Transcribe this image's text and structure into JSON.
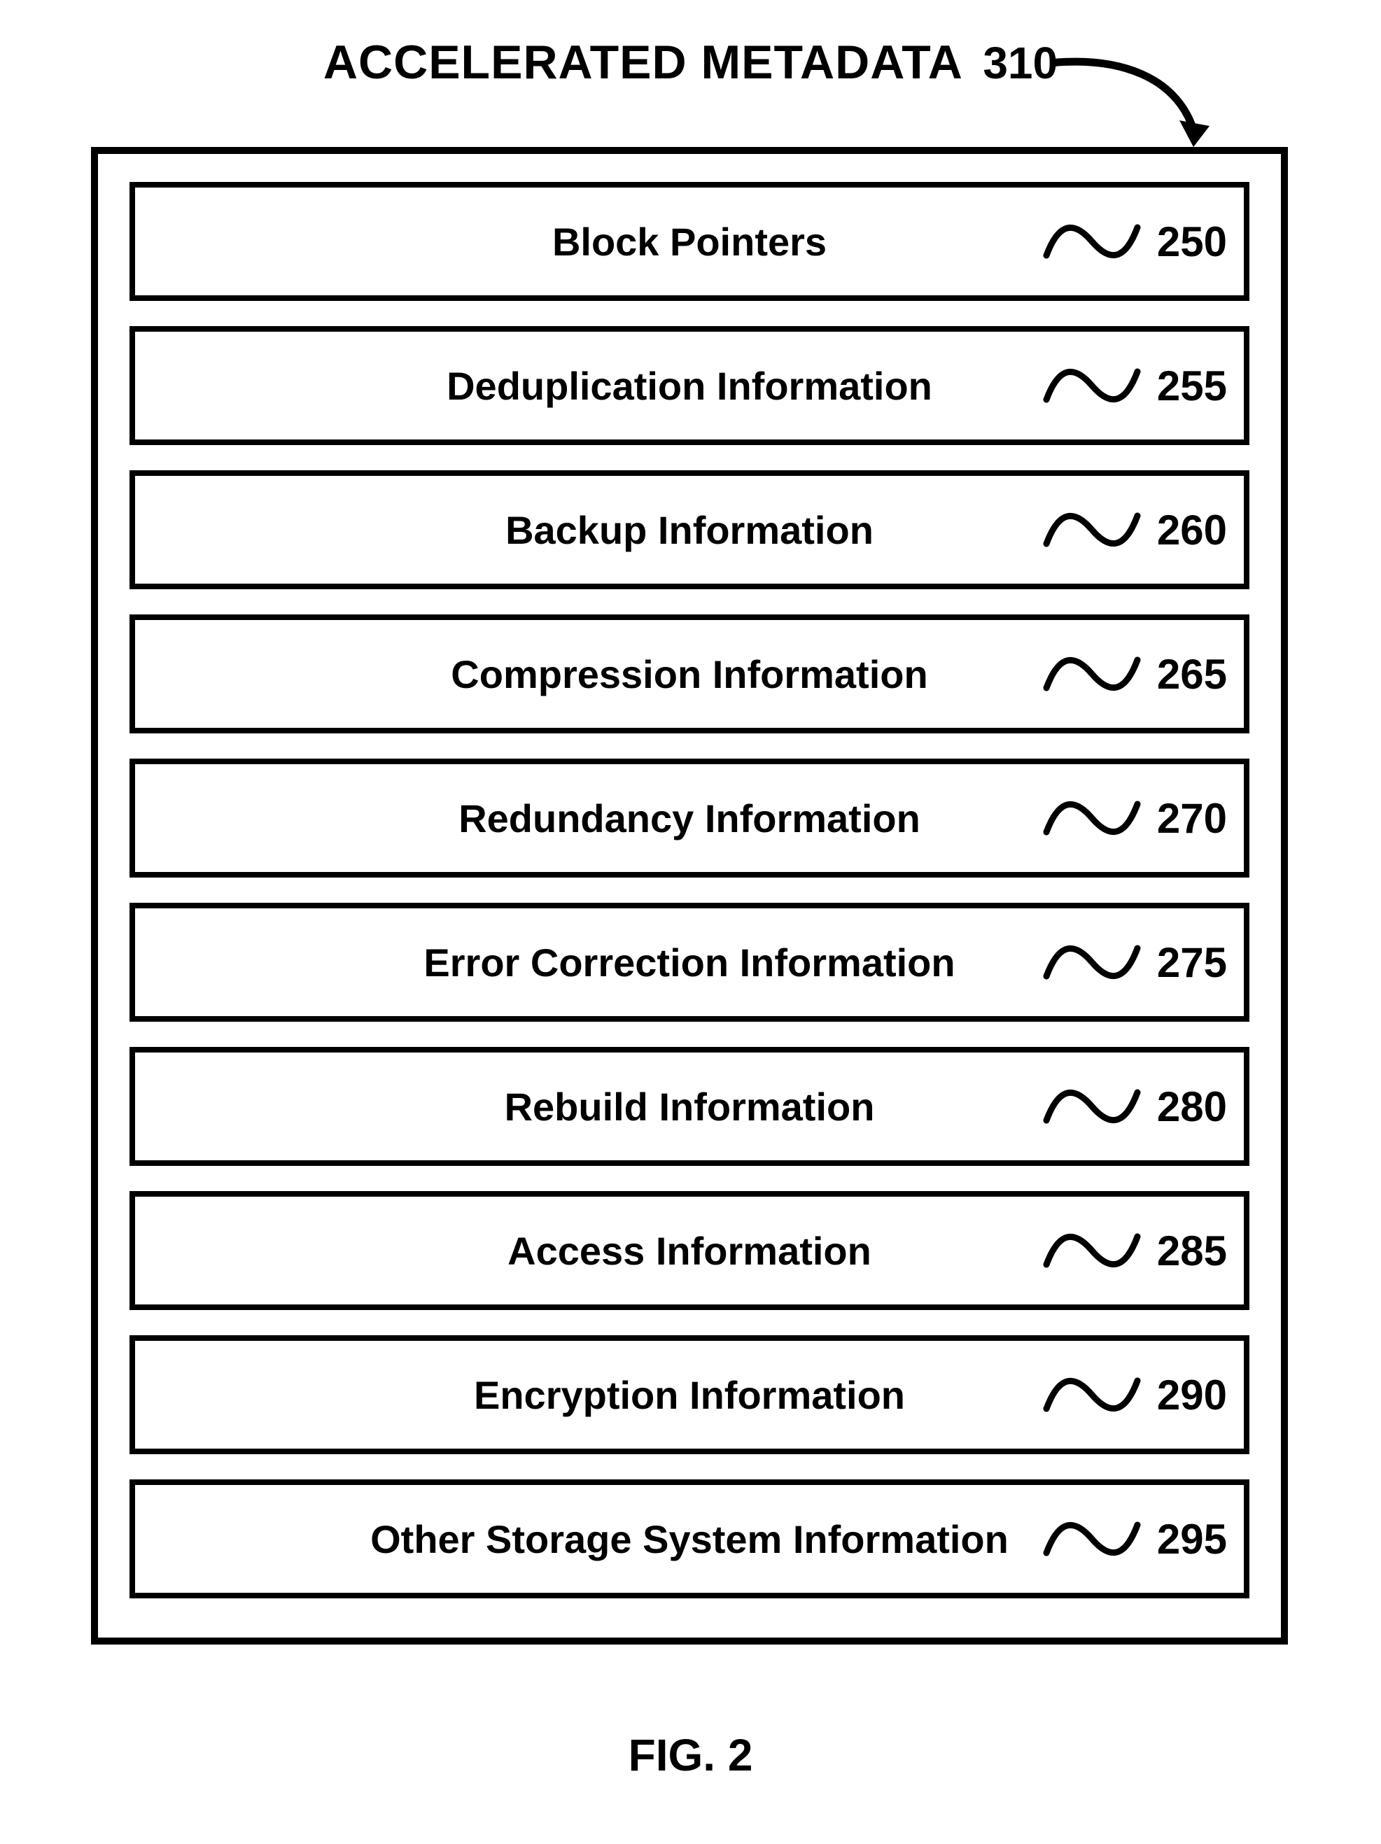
{
  "title": {
    "text": "ACCELERATED METADATA",
    "ref": "310"
  },
  "items": [
    {
      "label": "Block Pointers",
      "ref": "250"
    },
    {
      "label": "Deduplication Information",
      "ref": "255"
    },
    {
      "label": "Backup Information",
      "ref": "260"
    },
    {
      "label": "Compression Information",
      "ref": "265"
    },
    {
      "label": "Redundancy Information",
      "ref": "270"
    },
    {
      "label": "Error Correction Information",
      "ref": "275"
    },
    {
      "label": "Rebuild Information",
      "ref": "280"
    },
    {
      "label": "Access Information",
      "ref": "285"
    },
    {
      "label": "Encryption Information",
      "ref": "290"
    },
    {
      "label": "Other Storage System Information",
      "ref": "295"
    }
  ],
  "figure_caption": "FIG. 2"
}
